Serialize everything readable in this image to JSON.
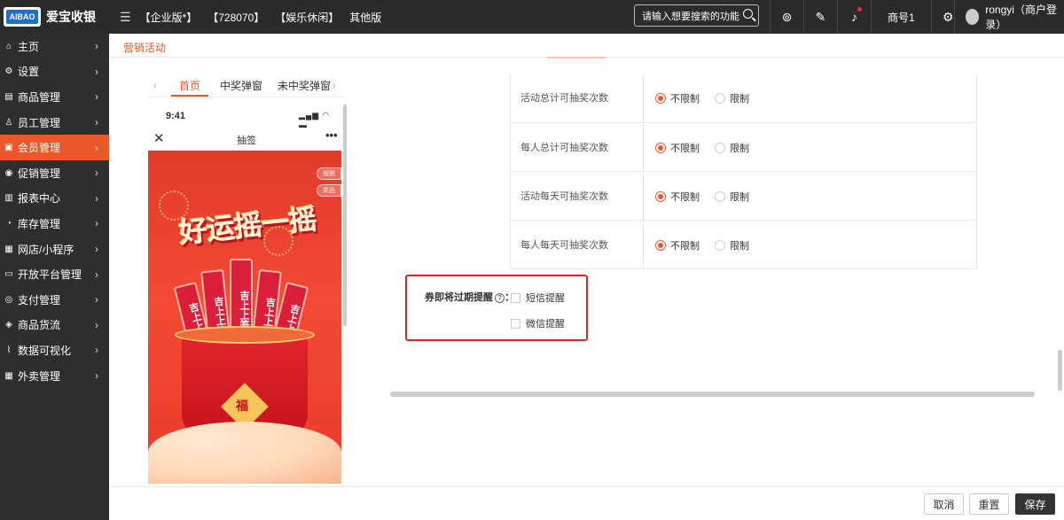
{
  "topbar": {
    "brand": "爱宝收银",
    "logo_text": "AIBAO",
    "tags": [
      "【企业版*】",
      "【728070】",
      "【娱乐休闲】",
      "其他版"
    ],
    "search_placeholder": "请输入想要搜索的功能",
    "store": "商号1",
    "user": "rongyi（商户登录）"
  },
  "sidebar": {
    "items": [
      {
        "label": "主页",
        "icon": "home-icon",
        "glyph": "⌂"
      },
      {
        "label": "设置",
        "icon": "gear-icon",
        "glyph": "⚙"
      },
      {
        "label": "商品管理",
        "icon": "goods-icon",
        "glyph": "▤"
      },
      {
        "label": "员工管理",
        "icon": "staff-icon",
        "glyph": "♙"
      },
      {
        "label": "会员管理",
        "icon": "member-icon",
        "glyph": "▣"
      },
      {
        "label": "促销管理",
        "icon": "promo-icon",
        "glyph": "◉"
      },
      {
        "label": "报表中心",
        "icon": "report-icon",
        "glyph": "▥"
      },
      {
        "label": "库存管理",
        "icon": "inventory-icon",
        "glyph": "◔"
      },
      {
        "label": "网店/小程序",
        "icon": "shop-icon",
        "glyph": "▦"
      },
      {
        "label": "开放平台管理",
        "icon": "platform-icon",
        "glyph": "▭"
      },
      {
        "label": "支付管理",
        "icon": "pay-icon",
        "glyph": "◎"
      },
      {
        "label": "商品货流",
        "icon": "logistics-icon",
        "glyph": "◈"
      },
      {
        "label": "数据可视化",
        "icon": "chart-icon",
        "glyph": "⌇"
      },
      {
        "label": "外卖管理",
        "icon": "takeout-icon",
        "glyph": "▦"
      }
    ],
    "active_index": 4
  },
  "header": {
    "title": "营销活动"
  },
  "preview": {
    "tabs": [
      "首页",
      "中奖弹窗",
      "未中奖弹窗"
    ],
    "time": "9:41",
    "nav_title": "抽签",
    "rule_label": "规则",
    "prize_label": "奖品",
    "headline": "好运摇一摇",
    "stick_text": [
      "吉上上签",
      "吉上上签",
      "吉上上签",
      "吉上上签",
      "吉上上签"
    ],
    "bucket_text": "福"
  },
  "settings": {
    "rows": [
      {
        "label": "活动总计可抽奖次数",
        "options": [
          "不限制",
          "限制"
        ],
        "selected": 0
      },
      {
        "label": "每人总计可抽奖次数",
        "options": [
          "不限制",
          "限制"
        ],
        "selected": 0
      },
      {
        "label": "活动每天可抽奖次数",
        "options": [
          "不限制",
          "限制"
        ],
        "selected": 0
      },
      {
        "label": "每人每天可抽奖次数",
        "options": [
          "不限制",
          "限制"
        ],
        "selected": 0
      }
    ]
  },
  "reminder": {
    "label": "券即将过期提醒",
    "help": "?",
    "colon": "：",
    "options": [
      "短信提醒",
      "微信提醒"
    ]
  },
  "footer": {
    "cancel": "取消",
    "reset": "重置",
    "save": "保存"
  },
  "colors": {
    "accent": "#e8582a",
    "highlight_border": "#e02424",
    "topbar": "#2b2b2b"
  }
}
